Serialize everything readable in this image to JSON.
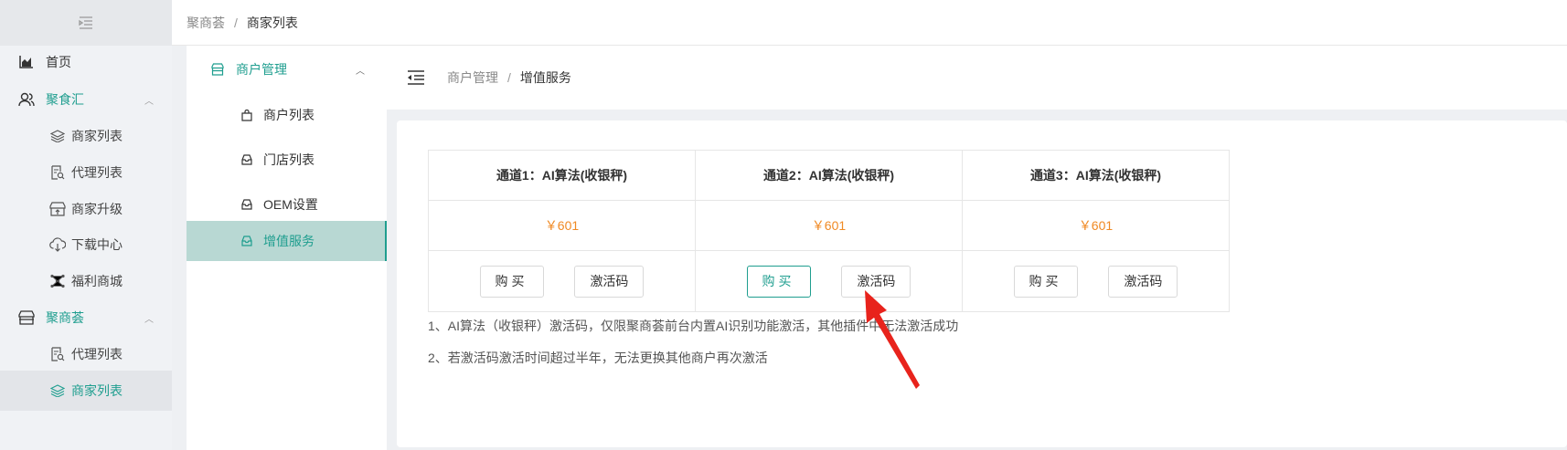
{
  "outer_sidebar": {
    "items": [
      {
        "label": "首页",
        "icon": "chart-area-icon"
      },
      {
        "label": "聚食汇",
        "icon": "users-icon"
      },
      {
        "label": "商家列表",
        "icon": "layers-icon"
      },
      {
        "label": "代理列表",
        "icon": "document-search-icon"
      },
      {
        "label": "商家升级",
        "icon": "store-upgrade-icon"
      },
      {
        "label": "下载中心",
        "icon": "download-icon"
      },
      {
        "label": "福利商城",
        "icon": "network-icon"
      },
      {
        "label": "聚商荟",
        "icon": "shop-icon"
      },
      {
        "label": "代理列表",
        "icon": "document-search-icon"
      },
      {
        "label": "商家列表",
        "icon": "layers-icon"
      }
    ]
  },
  "outer_breadcrumb": {
    "root": "聚商荟",
    "sep": "/",
    "current": "商家列表"
  },
  "inner_sidebar": {
    "group": "商户管理",
    "items": [
      {
        "label": "商户列表",
        "icon": "bag-icon"
      },
      {
        "label": "门店列表",
        "icon": "inbox-icon"
      },
      {
        "label": "OEM设置",
        "icon": "inbox-icon"
      },
      {
        "label": "增值服务",
        "icon": "inbox-icon"
      }
    ]
  },
  "inner_breadcrumb": {
    "root": "商户管理",
    "sep": "/",
    "current": "增值服务"
  },
  "channels": [
    {
      "title": "通道1：AI算法(收银秤)",
      "price": "￥601",
      "buy": "购买",
      "code": "激活码"
    },
    {
      "title": "通道2：AI算法(收银秤)",
      "price": "￥601",
      "buy": "购买",
      "code": "激活码"
    },
    {
      "title": "通道3：AI算法(收银秤)",
      "price": "￥601",
      "buy": "购买",
      "code": "激活码"
    }
  ],
  "notes": [
    "1、AI算法（收银秤）激活码，仅限聚商荟前台内置AI识别功能激活，其他插件中无法激活成功",
    "2、若激活码激活时间超过半年，无法更换其他商户再次激活"
  ],
  "colors": {
    "accent": "#1f9e8f",
    "price": "#f08a24",
    "annotation_arrow": "#e8231c"
  }
}
